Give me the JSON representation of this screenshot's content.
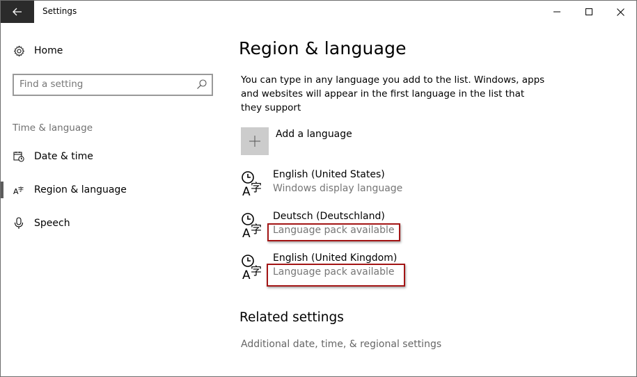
{
  "window": {
    "title": "Settings",
    "controls": {
      "minimize_icon": "minimize-icon",
      "maximize_icon": "maximize-icon",
      "close_icon": "close-icon"
    },
    "back_icon": "back-arrow-icon"
  },
  "sidebar": {
    "home": {
      "label": "Home",
      "icon": "gear-icon"
    },
    "search": {
      "placeholder": "Find a setting",
      "value": "",
      "icon": "search-icon"
    },
    "group_label": "Time & language",
    "items": [
      {
        "label": "Date & time",
        "icon": "calendar-clock-icon",
        "selected": false
      },
      {
        "label": "Region & language",
        "icon": "language-icon",
        "selected": true
      },
      {
        "label": "Speech",
        "icon": "microphone-icon",
        "selected": false
      }
    ]
  },
  "main": {
    "title": "Region & language",
    "intro": "You can type in any language you add to the list. Windows, apps and websites will appear in the first language in the list that they support",
    "add_language": {
      "label": "Add a language",
      "icon": "plus-icon"
    },
    "languages": [
      {
        "name": "English (United States)",
        "status": "Windows display language",
        "icon": "language-icon",
        "highlighted": false
      },
      {
        "name": "Deutsch (Deutschland)",
        "status": "Language pack available",
        "icon": "language-icon",
        "highlighted": true
      },
      {
        "name": "English (United Kingdom)",
        "status": "Language pack available",
        "icon": "language-icon",
        "highlighted": true
      }
    ],
    "related": {
      "title": "Related settings",
      "link": "Additional date, time, & regional settings"
    }
  },
  "colors": {
    "back_button_bg": "#2b2b2b",
    "add_tile_bg": "#cccccc",
    "highlight_border": "#a31515",
    "secondary_text": "#767676"
  }
}
